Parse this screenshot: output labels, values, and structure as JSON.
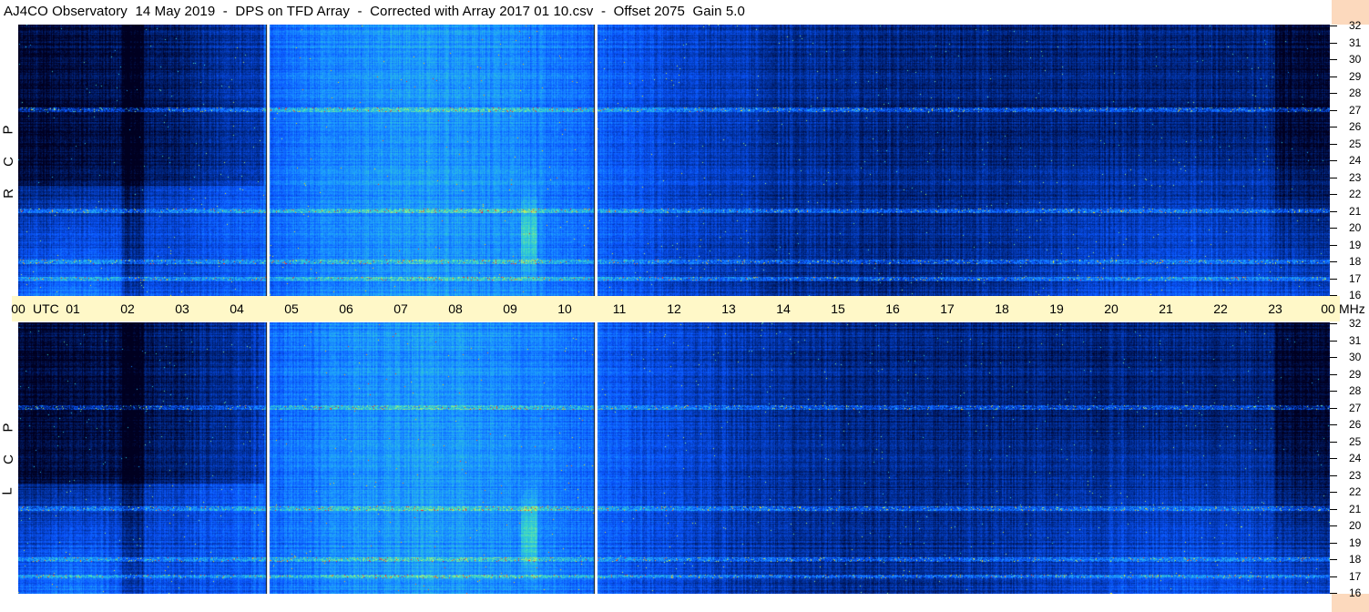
{
  "title": "AJ4CO Observatory  14 May 2019  -  DPS on TFD Array  -  Corrected with Array 2017 01 10.csv  -  Offset 2075  Gain 5.0",
  "chart_data": [
    {
      "type": "heatmap",
      "panel": "RCP",
      "polarization_letters": [
        "R",
        "C",
        "P"
      ],
      "x_axis": {
        "unit_label": "UTC",
        "ticks": [
          "00",
          "01",
          "02",
          "03",
          "04",
          "05",
          "06",
          "07",
          "08",
          "09",
          "10",
          "11",
          "12",
          "13",
          "14",
          "15",
          "16",
          "17",
          "18",
          "19",
          "20",
          "21",
          "22",
          "23",
          "00"
        ],
        "range_hours": [
          0,
          24
        ]
      },
      "y_axis": {
        "unit_label": "MHz",
        "ticks": [
          "32",
          "31",
          "30",
          "29",
          "28",
          "27",
          "26",
          "25",
          "24",
          "23",
          "22",
          "21",
          "20",
          "19",
          "18",
          "17",
          "16"
        ],
        "range_mhz": [
          16,
          32
        ]
      },
      "gaps_utc_hours": [
        4.57,
        10.57
      ],
      "bright_bands_mhz": [
        17,
        18,
        21,
        27
      ],
      "colormap": [
        "#000020",
        "#002a8c",
        "#0a55ff",
        "#1c9cff",
        "#38d7c8",
        "#b8f070",
        "#ffe000",
        "#ff2a2a"
      ]
    },
    {
      "type": "heatmap",
      "panel": "LCP",
      "polarization_letters": [
        "L",
        "C",
        "P"
      ],
      "x_axis": {
        "unit_label": "UTC",
        "ticks": [
          "00",
          "01",
          "02",
          "03",
          "04",
          "05",
          "06",
          "07",
          "08",
          "09",
          "10",
          "11",
          "12",
          "13",
          "14",
          "15",
          "16",
          "17",
          "18",
          "19",
          "20",
          "21",
          "22",
          "23",
          "00"
        ],
        "range_hours": [
          0,
          24
        ]
      },
      "y_axis": {
        "unit_label": "MHz",
        "ticks": [
          "32",
          "31",
          "30",
          "29",
          "28",
          "27",
          "26",
          "25",
          "24",
          "23",
          "22",
          "21",
          "20",
          "19",
          "18",
          "17",
          "16"
        ],
        "range_mhz": [
          16,
          32
        ]
      },
      "gaps_utc_hours": [
        4.57,
        10.57
      ],
      "bright_bands_mhz": [
        17,
        18,
        21,
        27
      ],
      "colormap": [
        "#000020",
        "#002a8c",
        "#0a55ff",
        "#1c9cff",
        "#38d7c8",
        "#b8f070",
        "#ffe000",
        "#ff2a2a"
      ]
    }
  ]
}
